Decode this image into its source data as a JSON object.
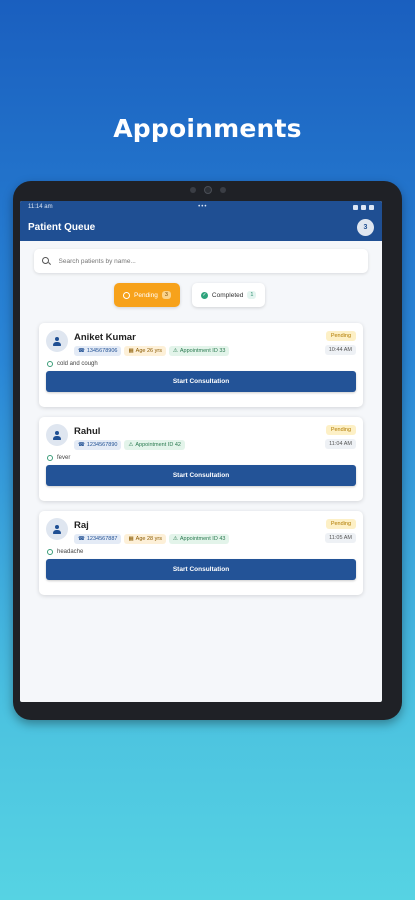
{
  "hero": {
    "title": "Appoinments"
  },
  "status_bar": {
    "time": "11:14 am",
    "center": "•••"
  },
  "app_bar": {
    "title": "Patient Queue",
    "avatar_initial": "3"
  },
  "search": {
    "placeholder": "Search patients by name..."
  },
  "tabs": {
    "pending": {
      "label": "Pending",
      "count": "3"
    },
    "completed": {
      "label": "Completed",
      "count": "1"
    }
  },
  "patients": [
    {
      "name": "Aniket Kumar",
      "phone": "1345678906",
      "age": "Age 26 yrs",
      "appointment": "Appointment ID 33",
      "status": "Pending",
      "time": "10:44 AM",
      "symptom": "cold and cough",
      "button": "Start Consultation"
    },
    {
      "name": "Rahul",
      "phone": "1234567890",
      "age": "",
      "appointment": "Appointment ID 42",
      "status": "Pending",
      "time": "11:04 AM",
      "symptom": "fever",
      "button": "Start Consultation"
    },
    {
      "name": "Raj",
      "phone": "1234567887",
      "age": "Age 28 yrs",
      "appointment": "Appointment ID 43",
      "status": "Pending",
      "time": "11:05 AM",
      "symptom": "headache",
      "button": "Start Consultation"
    }
  ],
  "colors": {
    "primary": "#1f4f93",
    "button": "#235397",
    "pending_tab": "#f7a21b",
    "completed_check": "#2ea37c"
  }
}
